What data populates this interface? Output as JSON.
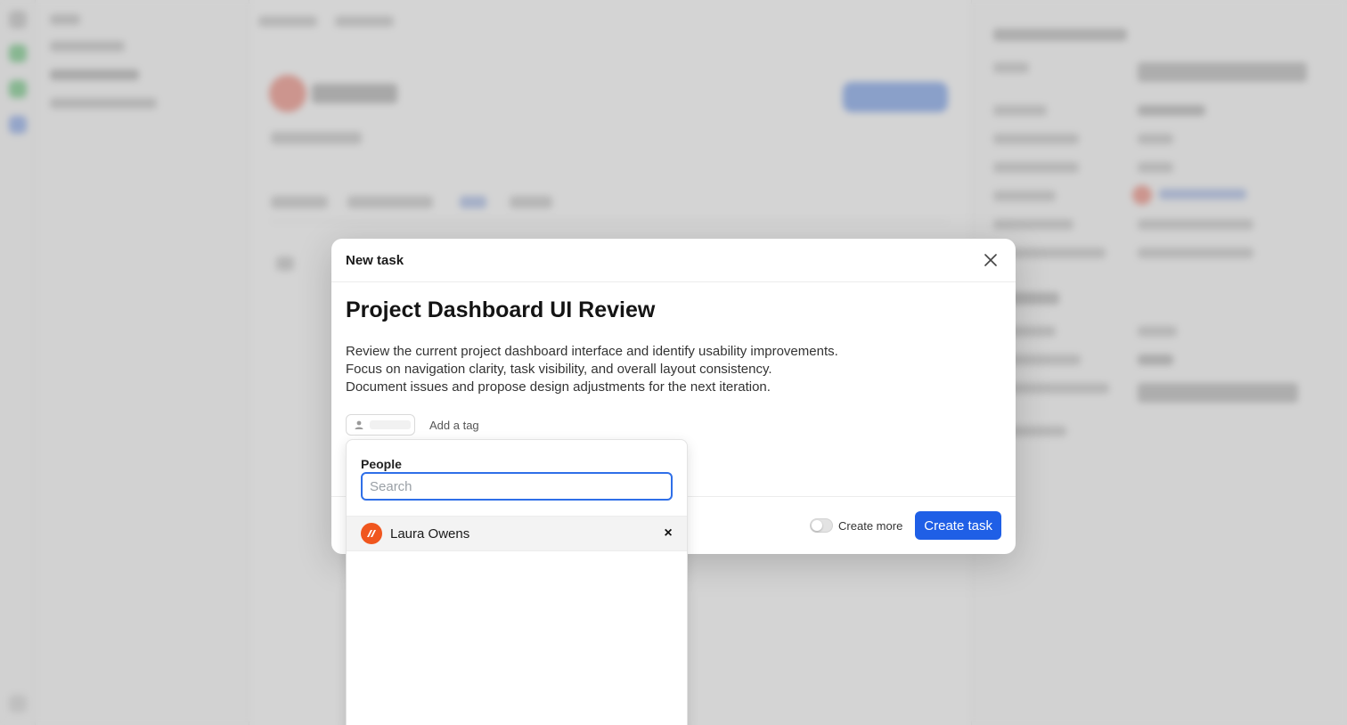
{
  "modal": {
    "title": "New task",
    "task_title": "Project Dashboard UI Review",
    "description": [
      "Review the current project dashboard interface and identify usability improvements.",
      "Focus on navigation clarity, task visibility, and overall layout consistency.",
      "Document issues and propose design adjustments for the next iteration."
    ],
    "add_tag_label": "Add a tag",
    "create_more_label": "Create more",
    "create_more_enabled": false,
    "create_button_label": "Create task"
  },
  "people_dropdown": {
    "label": "People",
    "search_placeholder": "Search",
    "search_value": "",
    "selected": [
      {
        "name": "Laura Owens"
      }
    ],
    "remove_symbol": "×"
  },
  "icons": {
    "close": "close-icon",
    "assignee": "user-icon",
    "avatar_logo": "brand-logo-icon"
  },
  "colors": {
    "accent": "#1f5fe6",
    "focus_ring": "#2f6fe8",
    "avatar_bg": "#f0561e"
  }
}
